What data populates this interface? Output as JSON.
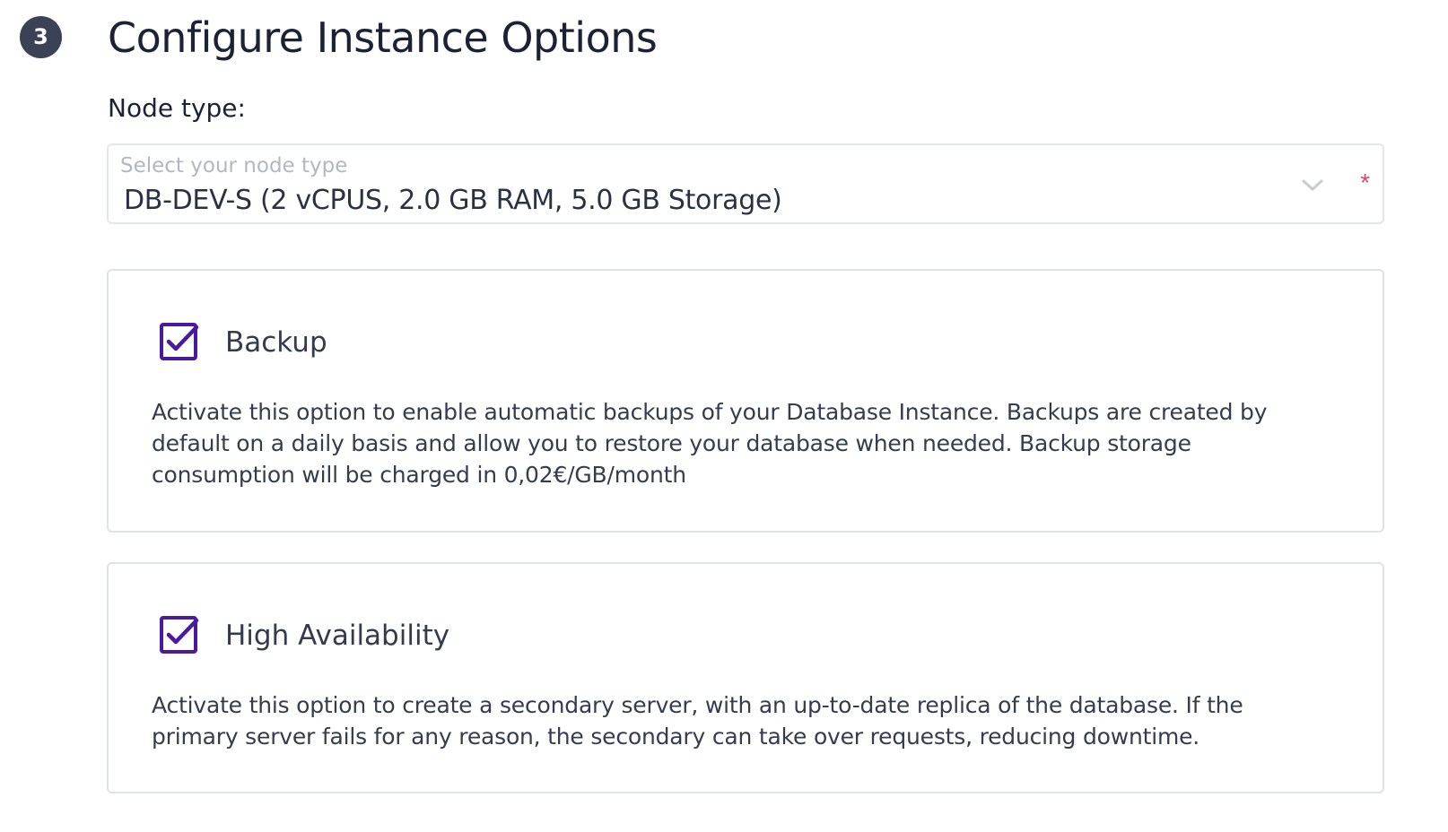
{
  "step": {
    "number": "3",
    "title": "Configure Instance Options"
  },
  "node_type": {
    "label": "Node type:",
    "placeholder": "Select your node type",
    "selected_value": "DB-DEV-S (2 vCPUS, 2.0 GB RAM, 5.0 GB Storage)",
    "required_marker": "*"
  },
  "options": {
    "backup": {
      "title": "Backup",
      "checked": true,
      "description": "Activate this option to enable automatic backups of your Database Instance. Backups are created by default on a daily basis and allow you to restore your database when needed. Backup storage consumption will be charged in 0,02€/GB/month"
    },
    "high_availability": {
      "title": "High Availability",
      "checked": true,
      "description": "Activate this option to create a secondary server, with an up-to-date replica of the database. If the primary server fails for any reason, the secondary can take over requests, reducing downtime."
    }
  },
  "colors": {
    "accent": "#4a1a9e",
    "required": "#e2456a",
    "step_badge": "#3b4256"
  }
}
